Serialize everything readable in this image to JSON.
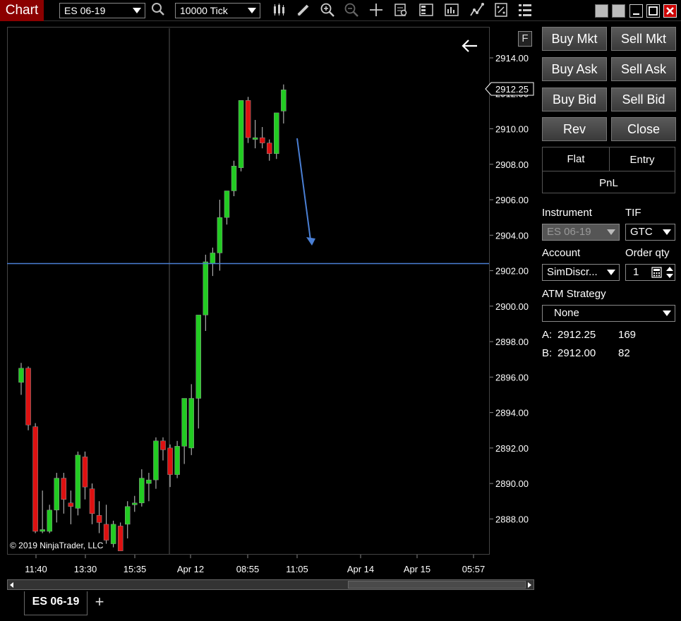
{
  "toolbar": {
    "title": "Chart",
    "instrument": "ES 06-19",
    "interval": "10000 Tick"
  },
  "chart": {
    "f_button": "F",
    "copyright": "© 2019 NinjaTrader, LLC",
    "price_marker": "2912.25",
    "horizontal_line_price": 2902.4,
    "price_range": [
      2886.2,
      2915.6
    ],
    "y_ticks": [
      "2914.00",
      "2912.00",
      "2910.00",
      "2908.00",
      "2906.00",
      "2904.00",
      "2902.00",
      "2900.00",
      "2898.00",
      "2896.00",
      "2894.00",
      "2892.00",
      "2890.00",
      "2888.00"
    ],
    "x_ticks": [
      "11:40",
      "13:30",
      "15:35",
      "Apr 12",
      "08:55",
      "11:05",
      "Apr 14",
      "Apr 15",
      "05:57"
    ],
    "bullish_color": "#22cc22",
    "bearish_color": "#dd1111",
    "line_color": "#4a7fd4",
    "candles": [
      {
        "o": 2895.7,
        "h": 2896.8,
        "l": 2895.0,
        "c": 2896.5
      },
      {
        "o": 2896.5,
        "h": 2896.6,
        "l": 2893.0,
        "c": 2893.3
      },
      {
        "o": 2893.2,
        "h": 2893.4,
        "l": 2887.2,
        "c": 2887.3
      },
      {
        "o": 2887.3,
        "h": 2889.6,
        "l": 2887.2,
        "c": 2887.4
      },
      {
        "o": 2887.3,
        "h": 2888.8,
        "l": 2887.2,
        "c": 2888.5
      },
      {
        "o": 2888.5,
        "h": 2890.6,
        "l": 2887.8,
        "c": 2890.3
      },
      {
        "o": 2890.3,
        "h": 2890.6,
        "l": 2888.3,
        "c": 2889.1
      },
      {
        "o": 2888.9,
        "h": 2889.6,
        "l": 2887.7,
        "c": 2888.7
      },
      {
        "o": 2888.6,
        "h": 2891.8,
        "l": 2888.2,
        "c": 2891.6
      },
      {
        "o": 2891.5,
        "h": 2891.8,
        "l": 2889.1,
        "c": 2889.8
      },
      {
        "o": 2889.7,
        "h": 2890.0,
        "l": 2887.7,
        "c": 2888.3
      },
      {
        "o": 2888.2,
        "h": 2889.0,
        "l": 2887.2,
        "c": 2887.8
      },
      {
        "o": 2887.7,
        "h": 2888.8,
        "l": 2886.6,
        "c": 2886.8
      },
      {
        "o": 2886.6,
        "h": 2887.9,
        "l": 2886.4,
        "c": 2887.7
      },
      {
        "o": 2887.6,
        "h": 2887.8,
        "l": 2886.3,
        "c": 2886.2
      },
      {
        "o": 2887.7,
        "h": 2889.0,
        "l": 2886.9,
        "c": 2888.7
      },
      {
        "o": 2888.8,
        "h": 2889.3,
        "l": 2888.4,
        "c": 2888.9
      },
      {
        "o": 2888.9,
        "h": 2890.8,
        "l": 2888.7,
        "c": 2890.3
      },
      {
        "o": 2890.0,
        "h": 2890.6,
        "l": 2889.0,
        "c": 2890.2
      },
      {
        "o": 2890.2,
        "h": 2892.6,
        "l": 2889.7,
        "c": 2892.4
      },
      {
        "o": 2892.4,
        "h": 2892.6,
        "l": 2891.3,
        "c": 2891.9
      },
      {
        "o": 2892.0,
        "h": 2892.2,
        "l": 2889.8,
        "c": 2890.5
      },
      {
        "o": 2890.5,
        "h": 2892.4,
        "l": 2890.3,
        "c": 2892.1
      },
      {
        "o": 2892.1,
        "h": 2894.2,
        "l": 2891.1,
        "c": 2894.8
      },
      {
        "o": 2892.0,
        "h": 2895.6,
        "l": 2891.6,
        "c": 2894.8
      },
      {
        "o": 2894.8,
        "h": 2896.2,
        "l": 2893.1,
        "c": 2899.5
      },
      {
        "o": 2899.5,
        "h": 2902.9,
        "l": 2898.6,
        "c": 2902.5
      },
      {
        "o": 2902.4,
        "h": 2903.3,
        "l": 2901.7,
        "c": 2903.0
      },
      {
        "o": 2903.0,
        "h": 2906.0,
        "l": 2902.0,
        "c": 2905.0
      },
      {
        "o": 2905.0,
        "h": 2906.5,
        "l": 2904.6,
        "c": 2906.5
      },
      {
        "o": 2906.5,
        "h": 2908.2,
        "l": 2906.2,
        "c": 2907.9
      },
      {
        "o": 2907.8,
        "h": 2908.8,
        "l": 2907.6,
        "c": 2911.6
      },
      {
        "o": 2911.6,
        "h": 2911.8,
        "l": 2909.2,
        "c": 2909.5
      },
      {
        "o": 2909.4,
        "h": 2910.5,
        "l": 2908.9,
        "c": 2909.5
      },
      {
        "o": 2909.5,
        "h": 2910.1,
        "l": 2908.9,
        "c": 2909.2
      },
      {
        "o": 2909.2,
        "h": 2909.4,
        "l": 2908.2,
        "c": 2908.6
      },
      {
        "o": 2908.6,
        "h": 2909.9,
        "l": 2908.3,
        "c": 2910.9
      },
      {
        "o": 2911.0,
        "h": 2912.5,
        "l": 2910.3,
        "c": 2912.2
      }
    ]
  },
  "order_buttons": {
    "buy_mkt": "Buy Mkt",
    "sell_mkt": "Sell Mkt",
    "buy_ask": "Buy Ask",
    "sell_ask": "Sell Ask",
    "buy_bid": "Buy Bid",
    "sell_bid": "Sell Bid",
    "rev": "Rev",
    "close": "Close"
  },
  "position": {
    "flat": "Flat",
    "entry": "Entry",
    "pnl": "PnL"
  },
  "fields": {
    "instrument_label": "Instrument",
    "instrument_value": "ES 06-19",
    "tif_label": "TIF",
    "tif_value": "GTC",
    "account_label": "Account",
    "account_value": "SimDiscr...",
    "order_qty_label": "Order qty",
    "order_qty_value": "1",
    "atm_label": "ATM Strategy",
    "atm_value": "None"
  },
  "quotes": {
    "ask_label": "A:",
    "ask_price": "2912.25",
    "ask_size": "169",
    "bid_label": "B:",
    "bid_price": "2912.00",
    "bid_size": "82"
  },
  "tabs": {
    "active": "ES 06-19",
    "add": "+"
  }
}
